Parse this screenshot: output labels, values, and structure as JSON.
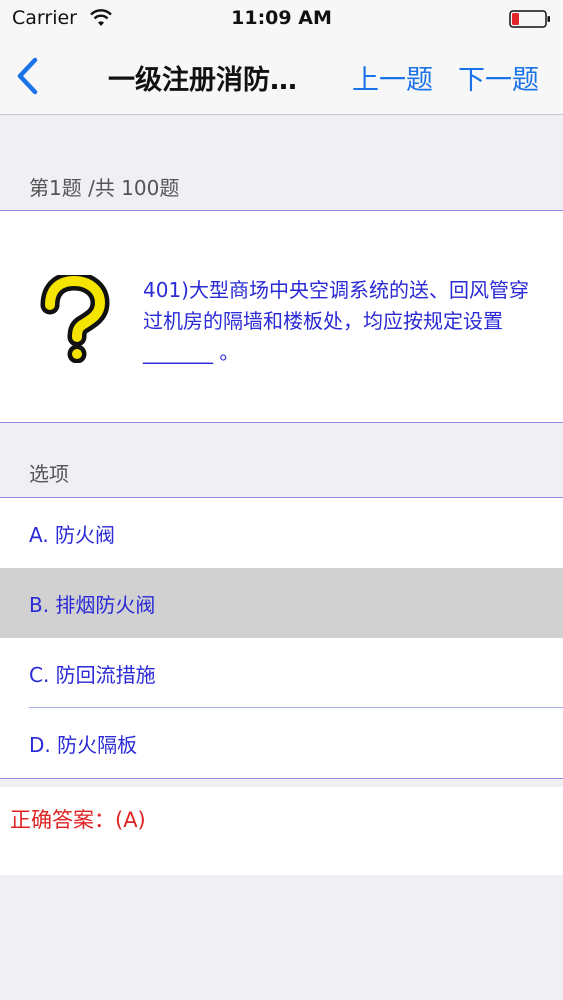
{
  "status_bar": {
    "carrier": "Carrier",
    "time": "11:09 AM",
    "icons": [
      "wifi-icon",
      "battery-low-icon"
    ]
  },
  "nav": {
    "title": "一级注册消防…",
    "prev_label": "上一题",
    "next_label": "下一题",
    "back_icon": "chevron-left-icon",
    "accent_color": "#1a73e8"
  },
  "question": {
    "counter": "第1题 /共 100题",
    "icon": "question-mark-icon",
    "text": "401)大型商场中央空调系统的送、回风管穿过机房的隔墙和楼板处，均应按规定设置_______ 。"
  },
  "options": {
    "label": "选项",
    "items": [
      {
        "text": "A.  防火阀",
        "selected": false
      },
      {
        "text": "B.  排烟防火阀",
        "selected": true
      },
      {
        "text": "C.  防回流措施",
        "selected": false
      },
      {
        "text": "D.  防火隔板",
        "selected": false
      }
    ]
  },
  "answer": {
    "text": "正确答案：(A)",
    "color": "#e02424"
  }
}
